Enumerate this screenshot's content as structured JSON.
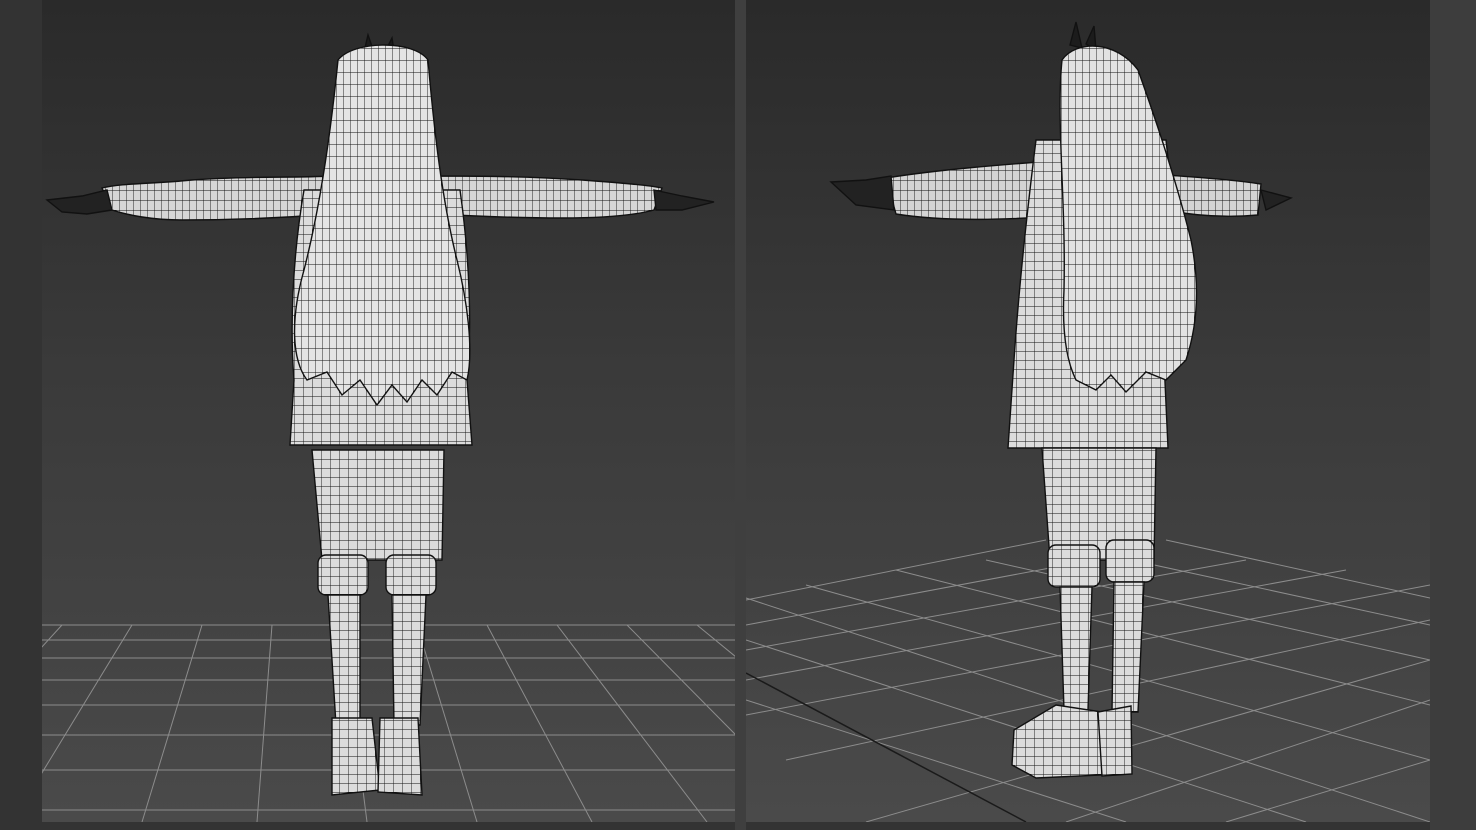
{
  "app": {
    "background_color": "#333333",
    "viewport_bg_top": "#2a2a2a",
    "viewport_bg_bottom": "#4a4a4a",
    "grid_color": "#8a8a8a",
    "axis_color": "#1a1a1a",
    "mesh_fill": "#d9d9d9",
    "mesh_line": "#111111"
  },
  "viewports": [
    {
      "name": "back-view",
      "projection": "orthographic",
      "view": "back"
    },
    {
      "name": "perspective-view",
      "projection": "perspective",
      "view": "three-quarter-back"
    }
  ],
  "model": {
    "type": "character-wireframe",
    "pose": "T-pose",
    "parts": [
      "hair",
      "hood-ears",
      "jacket",
      "sleeves",
      "shorts",
      "leg-warmers",
      "boots"
    ]
  }
}
